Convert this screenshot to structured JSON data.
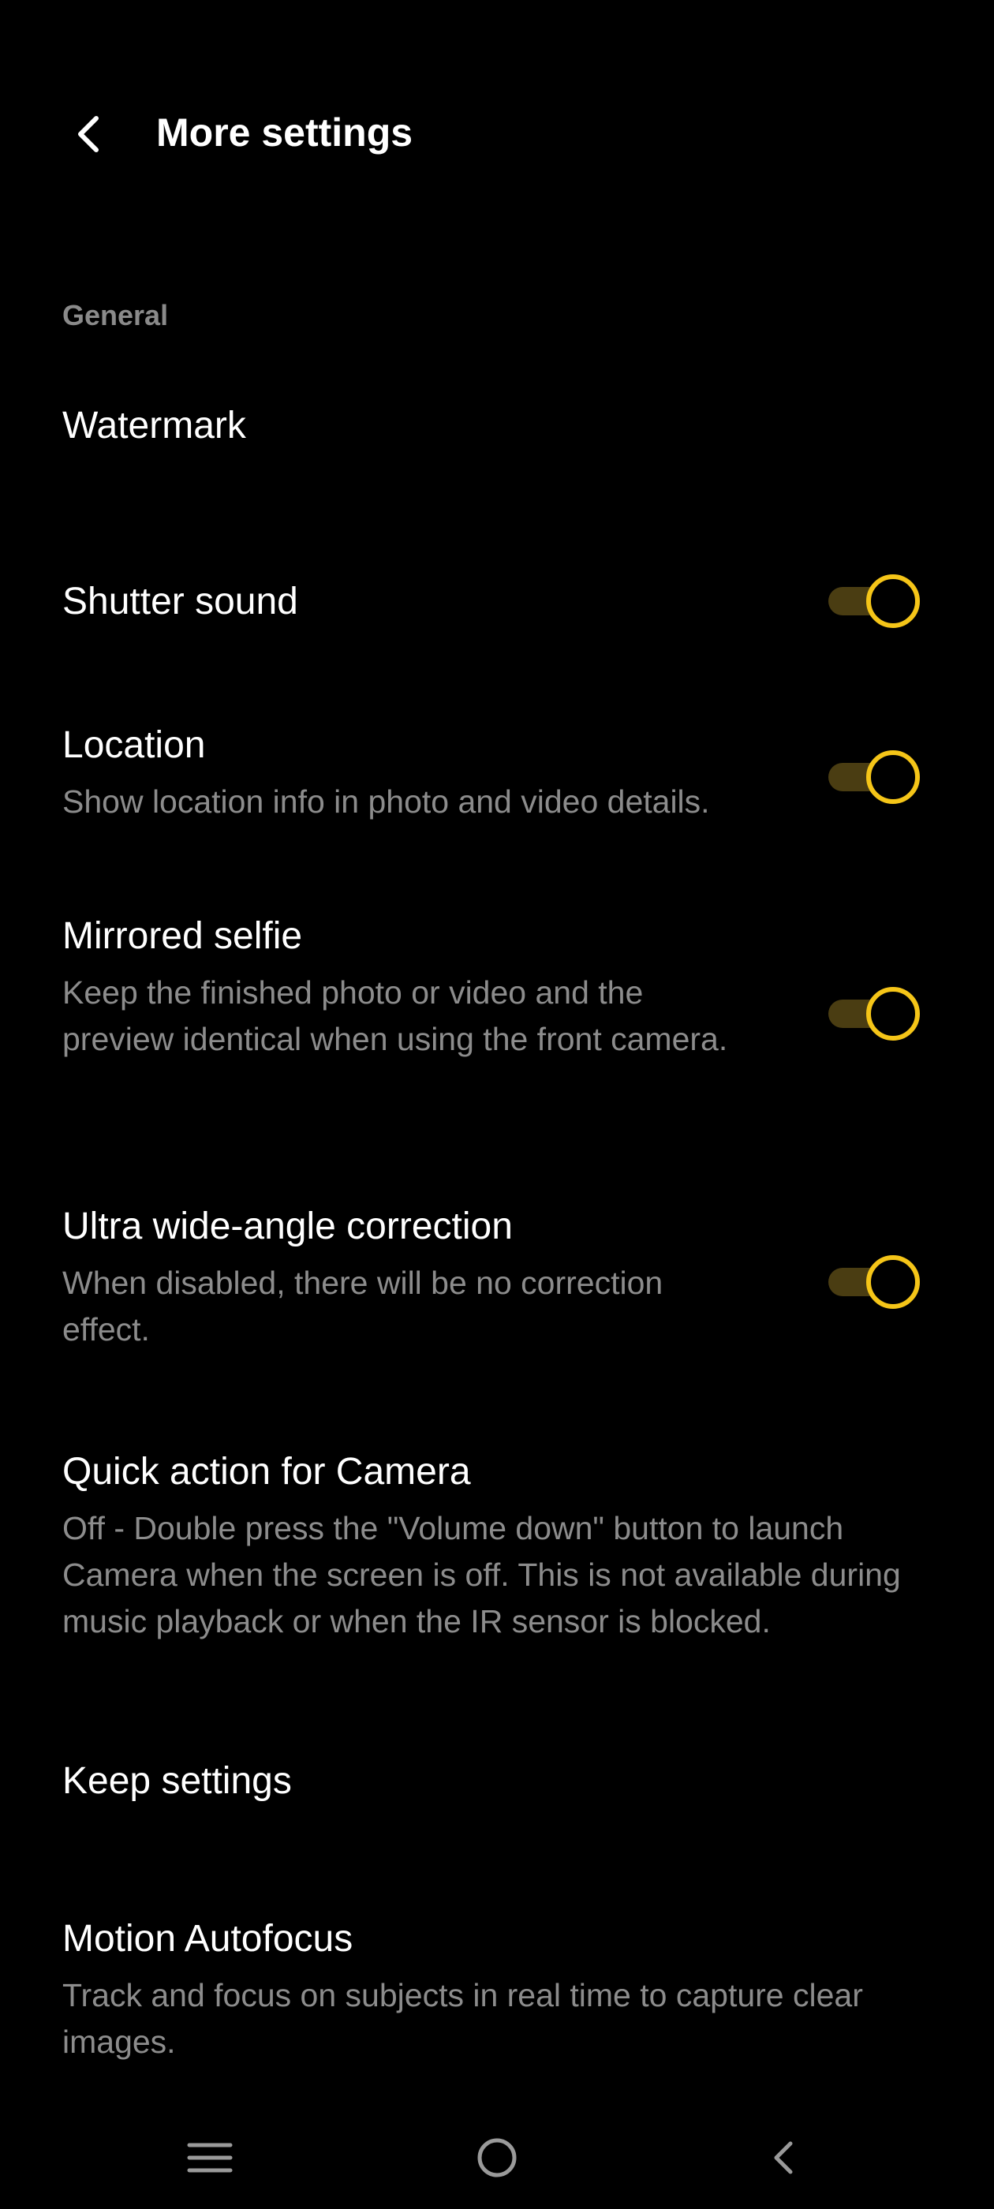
{
  "header": {
    "title": "More settings"
  },
  "section": {
    "label": "General"
  },
  "settings": [
    {
      "title": "Watermark",
      "description": ""
    },
    {
      "title": "Shutter sound",
      "description": "",
      "enabled": true
    },
    {
      "title": "Location",
      "description": "Show location info in photo and video details.",
      "enabled": true
    },
    {
      "title": "Mirrored selfie",
      "description": "Keep the finished photo or video and the preview identical when using the front camera.",
      "enabled": true
    },
    {
      "title": "Ultra wide-angle correction",
      "description": "When disabled, there will be no correction effect.",
      "enabled": true
    },
    {
      "title": "Quick action for Camera",
      "description": "Off - Double press the \"Volume down\" button to launch Camera when the screen is off. This is not available during music playback or when the IR sensor is blocked."
    },
    {
      "title": "Keep settings",
      "description": ""
    },
    {
      "title": "Motion Autofocus",
      "description": "Track and focus on subjects in real time to capture clear images."
    }
  ],
  "colors": {
    "background": "#000000",
    "accent": "#f5c518",
    "toggle_track": "#4a3d12",
    "secondary_text": "#8c8c8c"
  },
  "navbar": {
    "icons": [
      "menu-icon",
      "home-icon",
      "back-icon"
    ]
  }
}
